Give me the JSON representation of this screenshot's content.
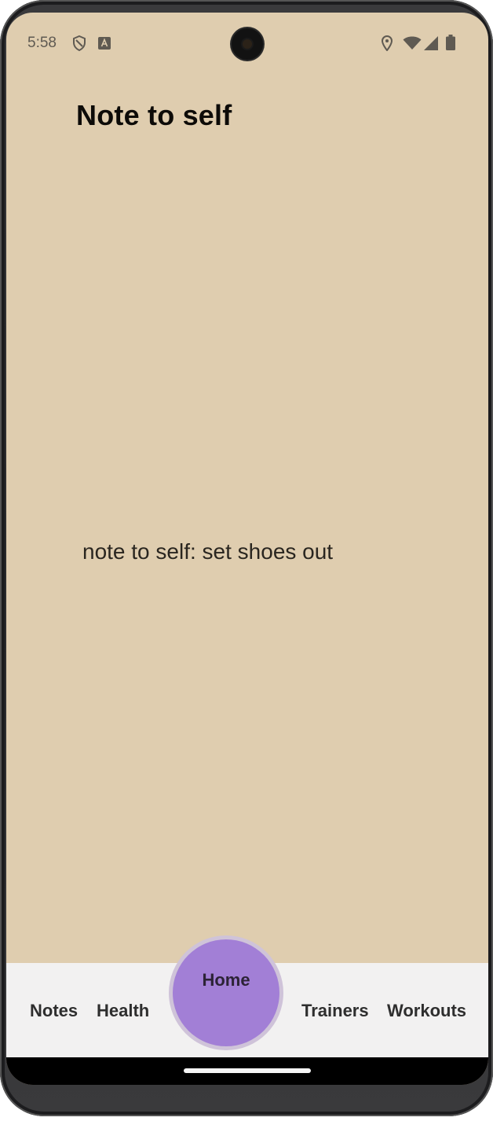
{
  "status_bar": {
    "time": "5:58",
    "icons": [
      "shield-icon",
      "keyboard-a-icon",
      "location-pin-icon",
      "wifi-icon",
      "cell-signal-icon",
      "battery-icon"
    ]
  },
  "page": {
    "title": "Note to self",
    "note": "note to self: set shoes out"
  },
  "bottom_nav": {
    "items": [
      {
        "label": "Notes"
      },
      {
        "label": "Health"
      },
      {
        "label": "Home"
      },
      {
        "label": "Trainers"
      },
      {
        "label": "Workouts"
      }
    ]
  },
  "colors": {
    "background": "#dfcdaf",
    "nav_background": "#f2f1f1",
    "home_fab": "#a27fd6"
  }
}
